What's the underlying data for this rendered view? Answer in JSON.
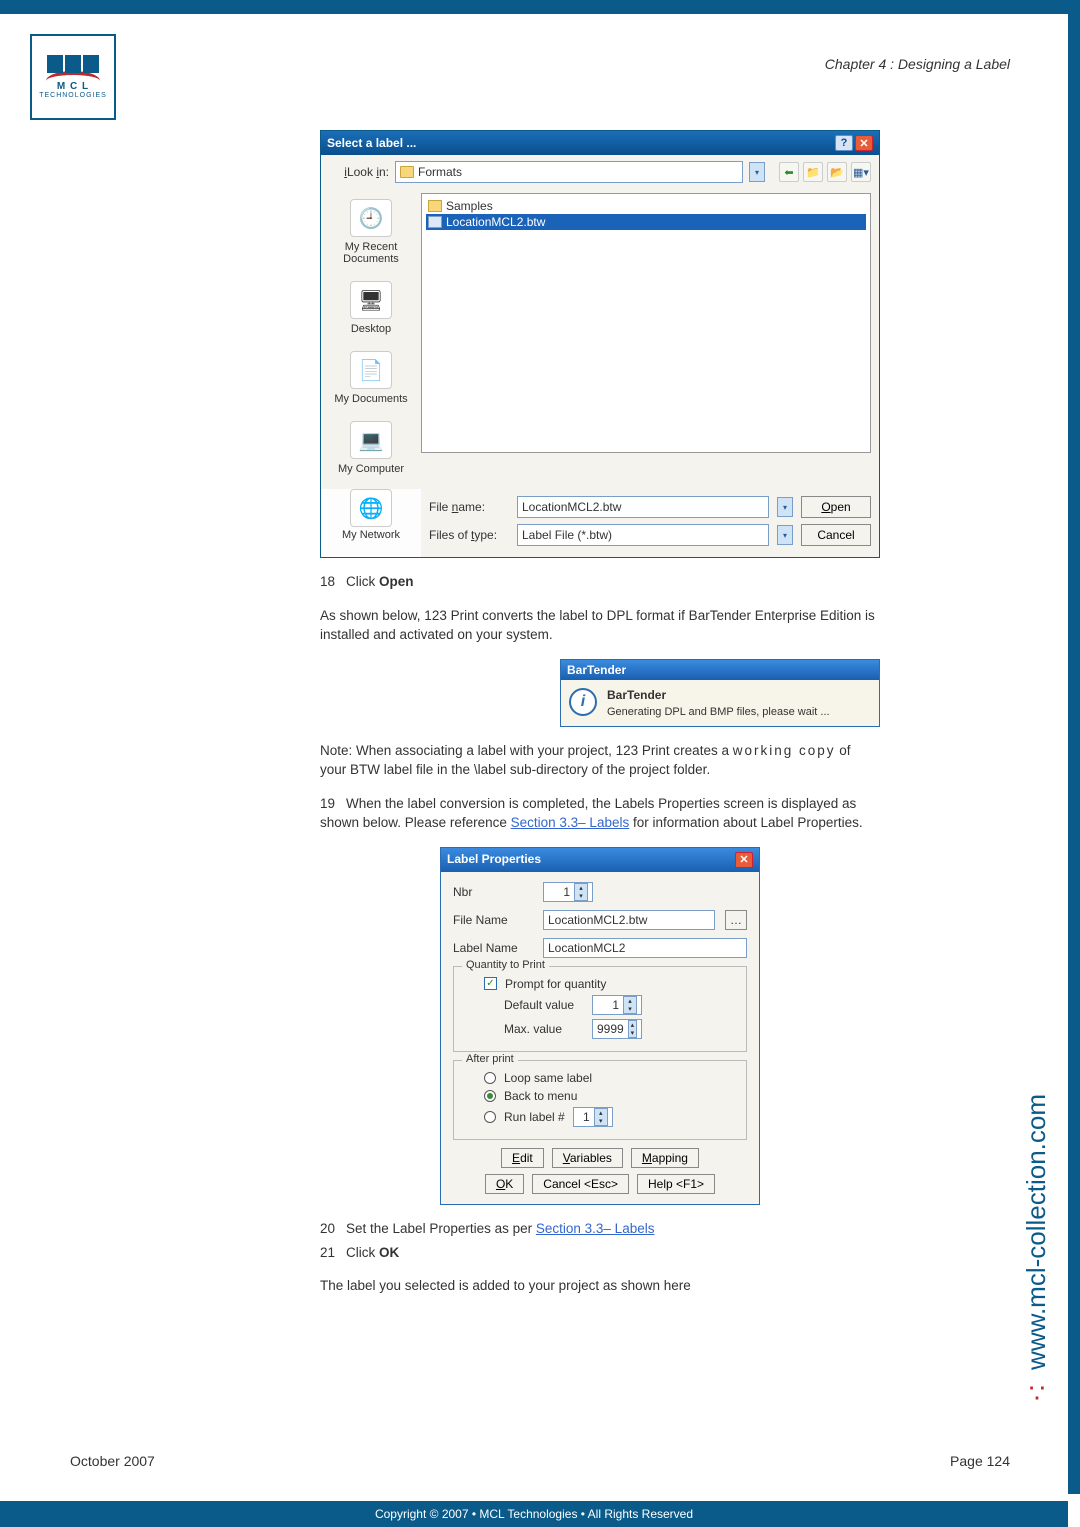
{
  "chapter": "Chapter 4 : Designing a Label",
  "logo": {
    "letters": "M C L",
    "sub": "TECHNOLOGIES"
  },
  "dlg1": {
    "title": "Select a label ...",
    "lookin_label": "Look in:",
    "lookin_value": "Formats",
    "files": {
      "folder": "Samples",
      "selected": "LocationMCL2.btw"
    },
    "places": {
      "recent": "My Recent Documents",
      "desktop": "Desktop",
      "mydocs": "My Documents",
      "mycomp": "My Computer",
      "mynet": "My Network"
    },
    "filename_label": "File name:",
    "filename_value": "LocationMCL2.btw",
    "filetype_label": "Files of type:",
    "filetype_value": "Label File (*.btw)",
    "open_btn": "Open",
    "cancel_btn": "Cancel"
  },
  "step18": {
    "num": "18",
    "text": "Click Open"
  },
  "para1": "As shown below, 123 Print converts the label to DPL format if BarTender Enterprise Edition is installed and activated on your system.",
  "bt": {
    "title": "BarTender",
    "heading": "BarTender",
    "msg": "Generating DPL and BMP files, please wait ..."
  },
  "note": {
    "prefix": "Note:  When associating a label with your project, 123 Print creates a ",
    "working": "working copy",
    "suffix": " of your BTW label file in the \\label sub-directory of the project folder."
  },
  "step19": {
    "num": "19",
    "a": "When the label conversion is completed, the Labels Properties screen is displayed as shown below. Please reference ",
    "link": "Section 3.3– Labels",
    "b": " for information about Label Properties."
  },
  "lp": {
    "title": "Label Properties",
    "nbr_label": "Nbr",
    "nbr_value": "1",
    "filename_label": "File Name",
    "filename_value": "LocationMCL2.btw",
    "labelname_label": "Label Name",
    "labelname_value": "LocationMCL2",
    "qty_legend": "Quantity to Print",
    "prompt_label": "Prompt for quantity",
    "default_label": "Default value",
    "default_value": "1",
    "max_label": "Max. value",
    "max_value": "9999",
    "after_legend": "After print",
    "loop_label": "Loop same label",
    "backmenu_label": "Back to menu",
    "runlabel_label": "Run label #",
    "runlabel_value": "1",
    "edit_btn": "Edit",
    "vars_btn": "Variables",
    "map_btn": "Mapping",
    "ok_btn": "OK",
    "cancel_btn": "Cancel <Esc>",
    "help_btn": "Help <F1>"
  },
  "step20": {
    "num": "20",
    "a": "Set the Label Properties as per ",
    "link": "Section 3.3– Labels"
  },
  "step21": {
    "num": "21",
    "text": "Click OK"
  },
  "para2": "The label you selected is added to your project as shown here",
  "url": "www.mcl-collection.com",
  "footer_date": "October 2007",
  "footer_page": "Page  124",
  "copyright": "Copyright © 2007 • MCL Technologies • All Rights Reserved"
}
